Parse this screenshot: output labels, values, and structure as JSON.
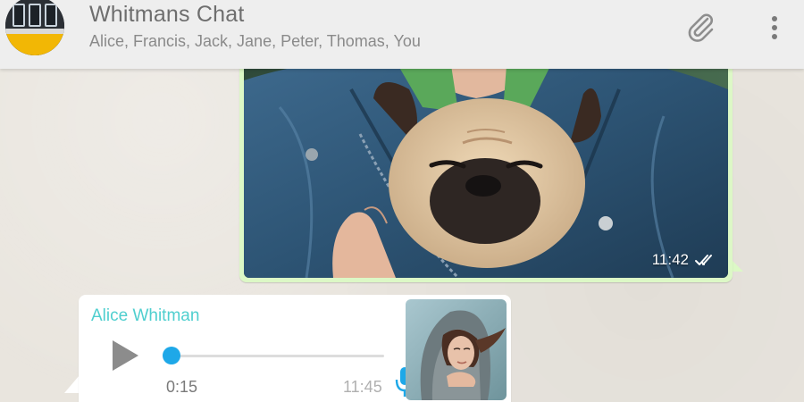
{
  "header": {
    "title": "Whitmans Chat",
    "participants": "Alice, Francis, Jack, Jane, Peter, Thomas, You",
    "avatar_icon": "bus-window-group-avatar",
    "attach_icon": "paperclip-icon",
    "menu_icon": "more-vertical-icon"
  },
  "messages": [
    {
      "direction": "outgoing",
      "kind": "image",
      "image_subject": "person holding a pug in a denim jacket",
      "time": "11:42",
      "status_icon": "double-check-icon"
    },
    {
      "direction": "incoming",
      "kind": "voice",
      "sender": "Alice Whitman",
      "duration": "0:15",
      "time": "11:45",
      "playback_progress": 0.0,
      "colors": {
        "sender_name": "#4fcfcf",
        "progress": "#1ea8e8",
        "mic": "#1ea8e8"
      }
    }
  ],
  "colors": {
    "outgoing_bubble": "#dcf8c6",
    "incoming_bubble": "#ffffff",
    "header_bg": "#eeeeee",
    "chat_bg": "#e9e5de"
  }
}
